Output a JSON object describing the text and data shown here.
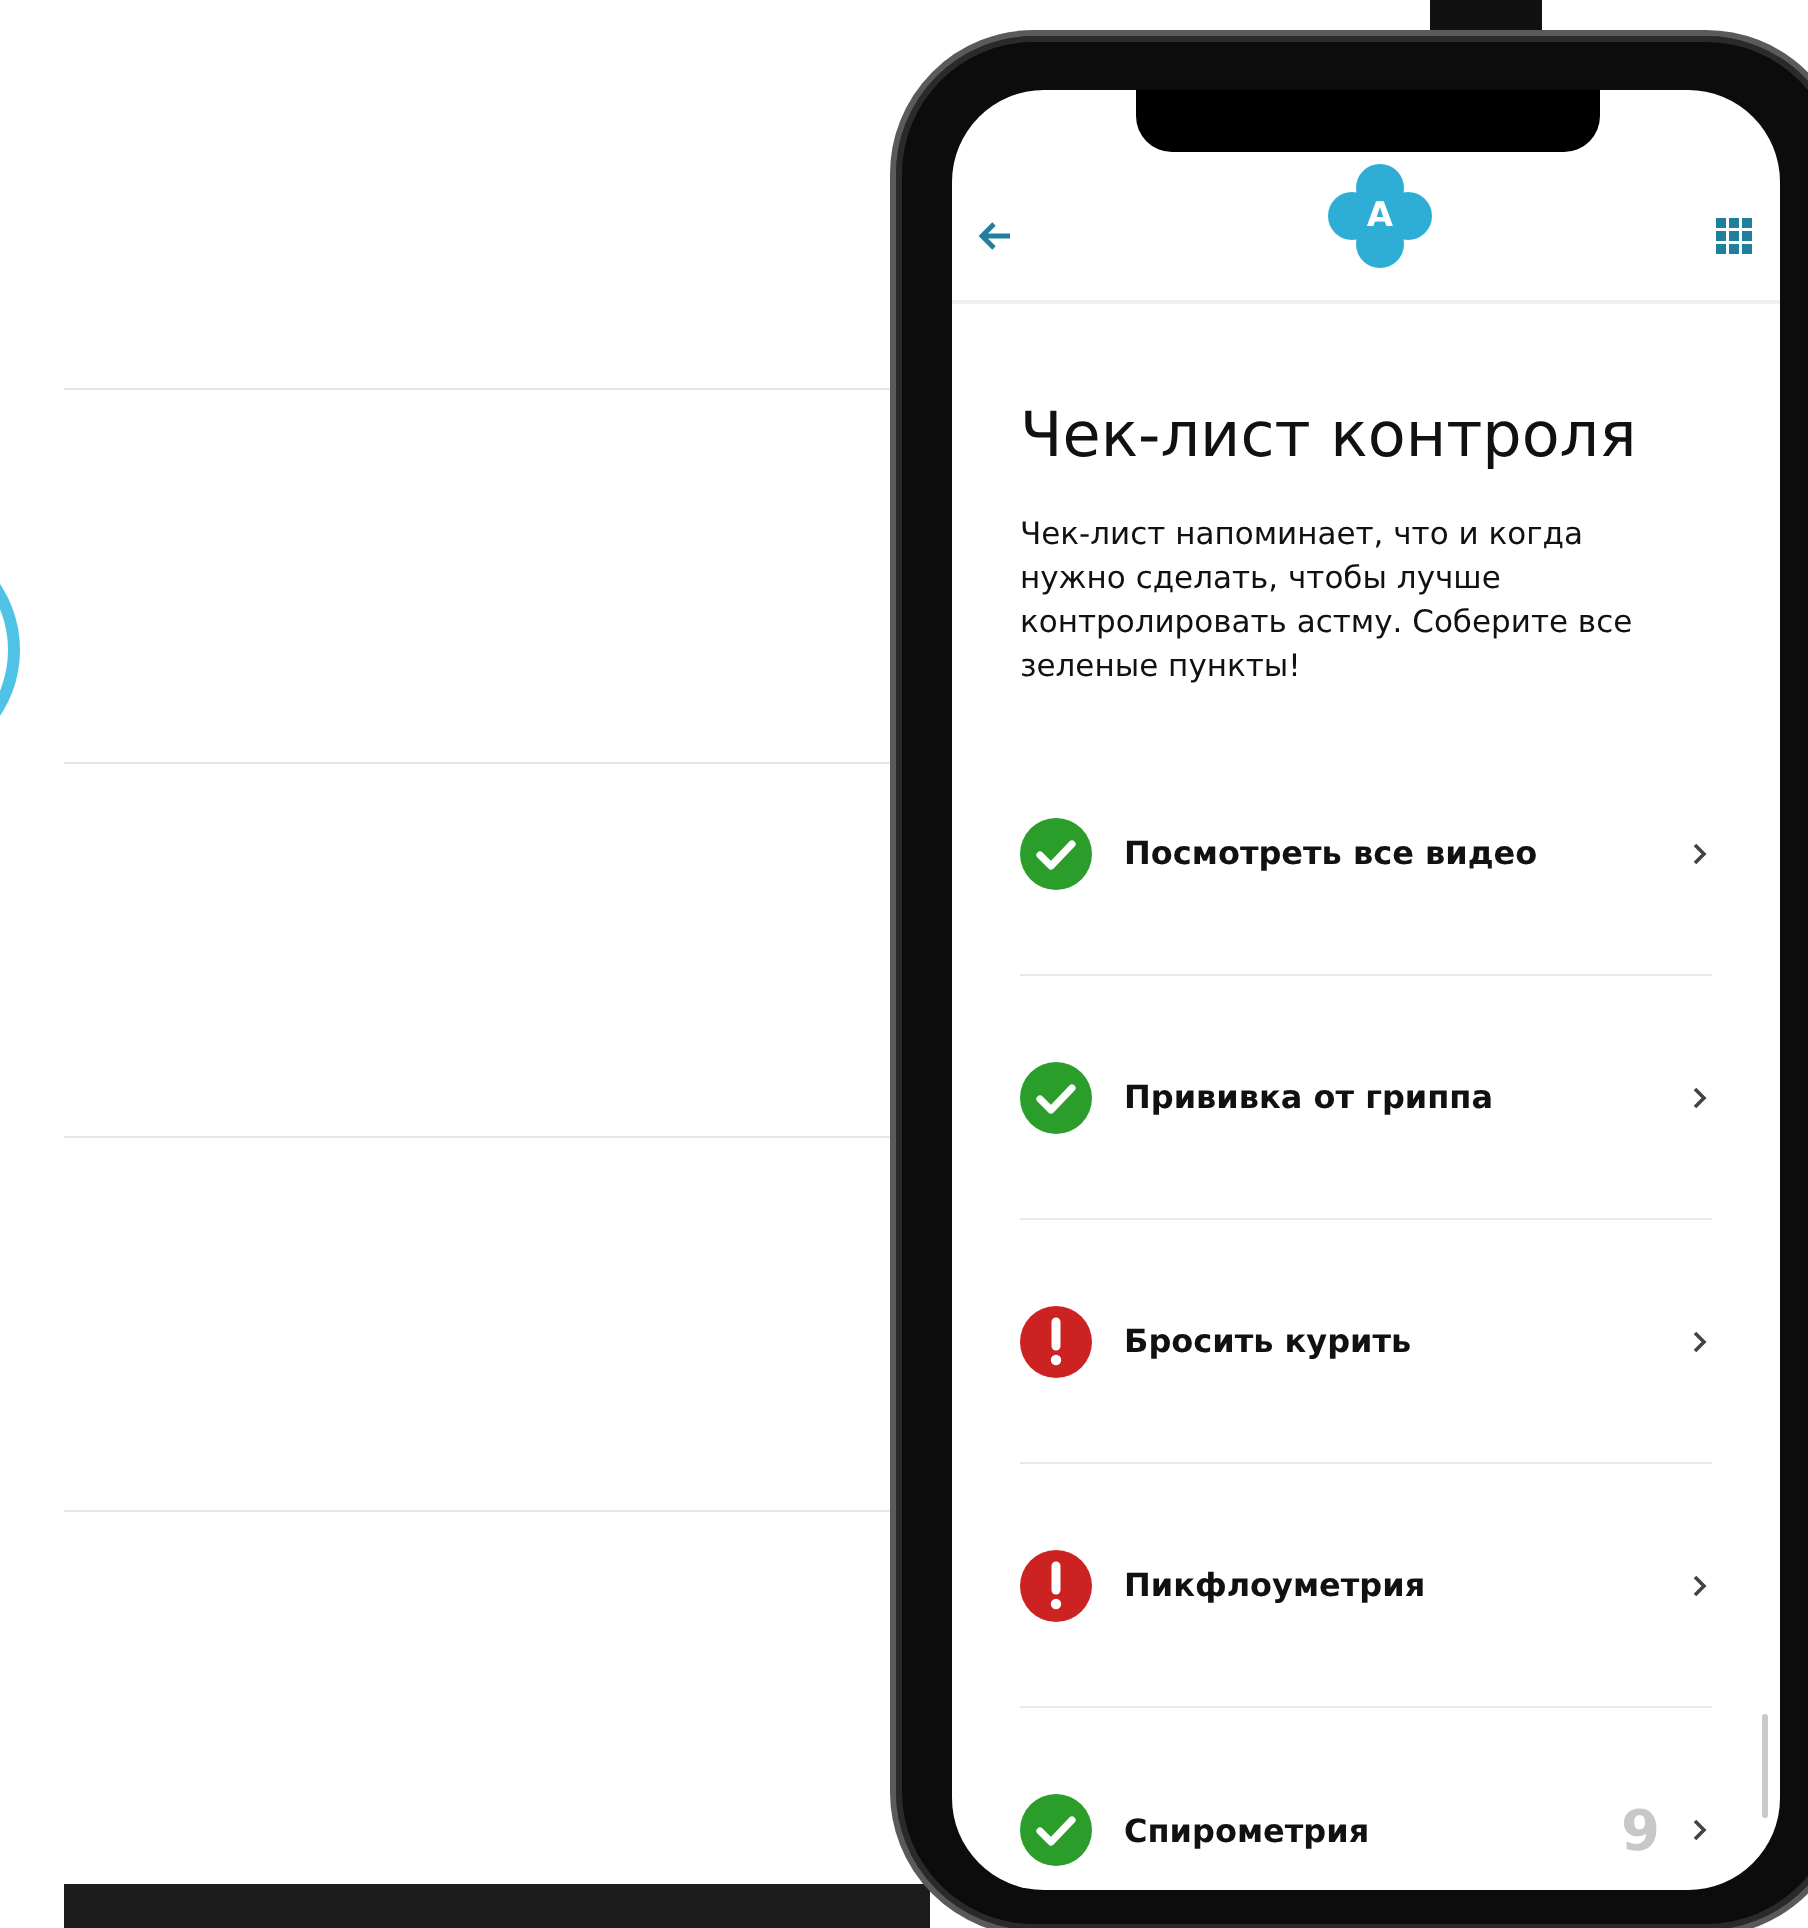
{
  "header": {
    "logo_letter": "A"
  },
  "title": "Чек-лист контроля",
  "description": "Чек-лист напоминает, что и когда нужно сделать, чтобы лучше контролировать астму. Соберите все зеленые пункты!",
  "items": [
    {
      "label": "Посмотреть все видео",
      "kind": "done"
    },
    {
      "label": "Прививка от гриппа",
      "kind": "done"
    },
    {
      "label": "Бросить курить",
      "kind": "warning"
    },
    {
      "label": "Пикфлоуметрия",
      "kind": "warning"
    },
    {
      "label": "Спирометрия",
      "kind": "done",
      "badge": "9"
    }
  ]
}
